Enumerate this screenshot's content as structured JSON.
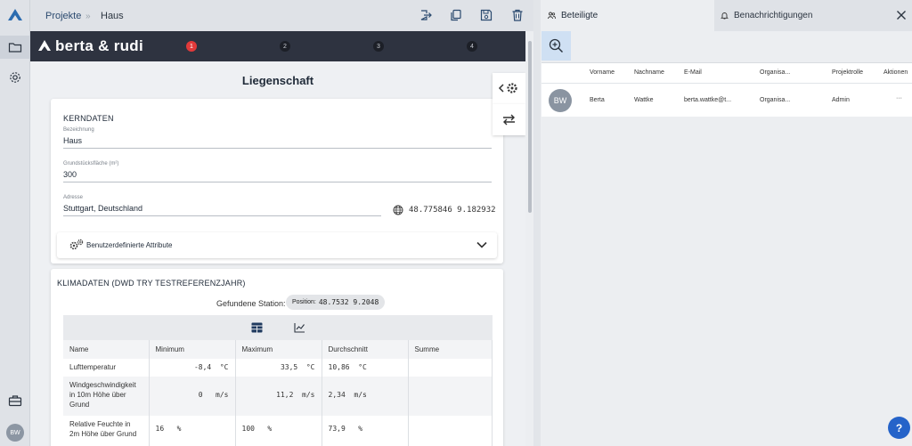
{
  "nav": {
    "user_initials": "BW"
  },
  "breadcrumb": {
    "projects": "Projekte",
    "separator": "»",
    "current": "Haus"
  },
  "brand": {
    "logo_text": "berta & rudi",
    "steps": [
      "1",
      "2",
      "3",
      "4"
    ]
  },
  "page": {
    "title": "Liegenschaft"
  },
  "kerndaten": {
    "heading": "KERNDATEN",
    "bezeichnung_label": "Bezeichnung",
    "bezeichnung_value": "Haus",
    "flaeche_label": "Grundstücksfläche (m²)",
    "flaeche_value": "300",
    "adresse_label": "Adresse",
    "adresse_value": "Stuttgart, Deutschland",
    "coordinates": "48.775846 9.182932",
    "custom_attributes_label": "Benutzerdefinierte Attribute"
  },
  "klima": {
    "heading": "KLIMADATEN (DWD TRY TESTREFERENZJAHR)",
    "station_label": "Gefundene Station:",
    "position_label": "Position:",
    "position_value": "48.7532 9.2048",
    "columns": [
      "Name",
      "Minimum",
      "Maximum",
      "Durchschnitt",
      "Summe"
    ],
    "rows": [
      {
        "name": "Lufttemperatur",
        "min": "-8,4  °C",
        "max": "33,5  °C",
        "avg": "10,86  °C",
        "sum": ""
      },
      {
        "name": "Windgeschwindigkeit in 10m Höhe über Grund",
        "min": "0   m/s",
        "max": "11,2  m/s",
        "avg": "2,34  m/s",
        "sum": ""
      },
      {
        "name": "Relative Feuchte in 2m Höhe über Grund",
        "min": "16   %",
        "max": "100   %",
        "avg": "73,9   %",
        "sum": ""
      }
    ]
  },
  "right_panel": {
    "tab_active": "Beteiligte",
    "tab_inactive": "Benachrichtigungen",
    "columns": [
      "Vorname",
      "Nachname",
      "E-Mail",
      "Organisa...",
      "Projektrolle",
      "Aktionen"
    ],
    "row": {
      "initials": "BW",
      "vorname": "Berta",
      "nachname": "Wattke",
      "email": "berta.wattke@t...",
      "organisation": "Organisa...",
      "rolle": "Admin",
      "actions": "···"
    }
  },
  "help": {
    "label": "?"
  },
  "colors": {
    "brand_dark": "#2e3340",
    "active_step": "#e23a3a",
    "help_button": "#2563c9",
    "add_button_bg": "#cfe0f3"
  }
}
